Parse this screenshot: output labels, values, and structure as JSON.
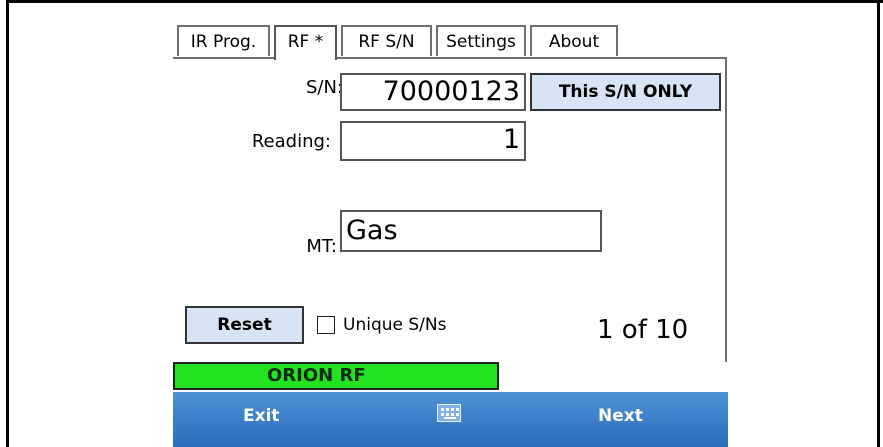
{
  "tabs": [
    {
      "label": "IR Prog.",
      "active": false
    },
    {
      "label": "RF *",
      "active": true
    },
    {
      "label": "RF S/N",
      "active": false
    },
    {
      "label": "Settings",
      "active": false
    },
    {
      "label": "About",
      "active": false
    }
  ],
  "form": {
    "sn_label": "S/N:",
    "sn_value": "70000123",
    "reading_label": "Reading:",
    "reading_value": "1",
    "mt_label": "MT:",
    "mt_value": "Gas"
  },
  "buttons": {
    "this_sn_only": "This S/N ONLY",
    "reset": "Reset"
  },
  "unique_sns": {
    "label": "Unique S/Ns",
    "checked": false
  },
  "counter": "1 of 10",
  "status": "ORION RF",
  "softkeys": {
    "left": "Exit",
    "right": "Next"
  },
  "icons": {
    "keyboard": "keyboard-icon"
  },
  "colors": {
    "status_bar": "#22e222",
    "softbar": "#2a6cb8",
    "button": "#d6e4f5"
  }
}
